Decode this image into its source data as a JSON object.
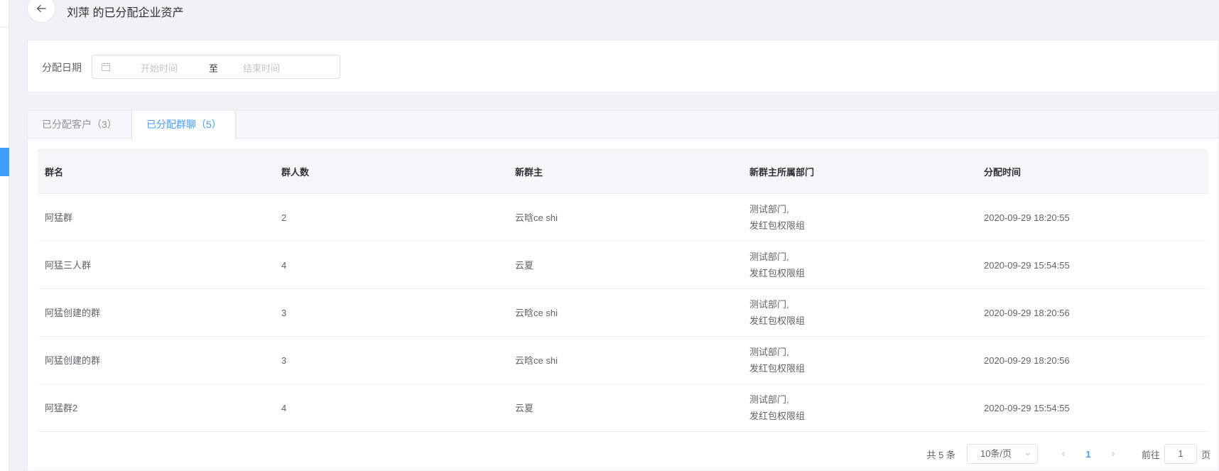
{
  "header": {
    "title": "刘萍 的已分配企业资产"
  },
  "filter": {
    "label": "分配日期",
    "start_placeholder": "开始时间",
    "separator": "至",
    "end_placeholder": "结束时间"
  },
  "tabs": [
    {
      "label": "已分配客户（3）"
    },
    {
      "label": "已分配群聊（5）"
    }
  ],
  "table": {
    "headers": [
      "群名",
      "群人数",
      "新群主",
      "新群主所属部门",
      "分配时间"
    ],
    "rows": [
      {
        "name": "阿猛群",
        "count": "2",
        "owner": "云晗ce shi",
        "dept1": "测试部门,",
        "dept2": "发红包权限组",
        "time": "2020-09-29 18:20:55"
      },
      {
        "name": "阿猛三人群",
        "count": "4",
        "owner": "云夏",
        "dept1": "测试部门,",
        "dept2": "发红包权限组",
        "time": "2020-09-29 15:54:55"
      },
      {
        "name": "阿猛创建的群",
        "count": "3",
        "owner": "云晗ce shi",
        "dept1": "测试部门,",
        "dept2": "发红包权限组",
        "time": "2020-09-29 18:20:56"
      },
      {
        "name": "阿猛创建的群",
        "count": "3",
        "owner": "云晗ce shi",
        "dept1": "测试部门,",
        "dept2": "发红包权限组",
        "time": "2020-09-29 18:20:56"
      },
      {
        "name": "阿猛群2",
        "count": "4",
        "owner": "云夏",
        "dept1": "测试部门,",
        "dept2": "发红包权限组",
        "time": "2020-09-29 15:54:55"
      }
    ]
  },
  "pagination": {
    "total": "共 5 条",
    "page_size": "10条/页",
    "current_page": "1",
    "goto_label": "前往",
    "goto_value": "1",
    "page_suffix": "页"
  },
  "colors": {
    "accent": "#409eff",
    "page_bg": "#f0f2f5"
  }
}
